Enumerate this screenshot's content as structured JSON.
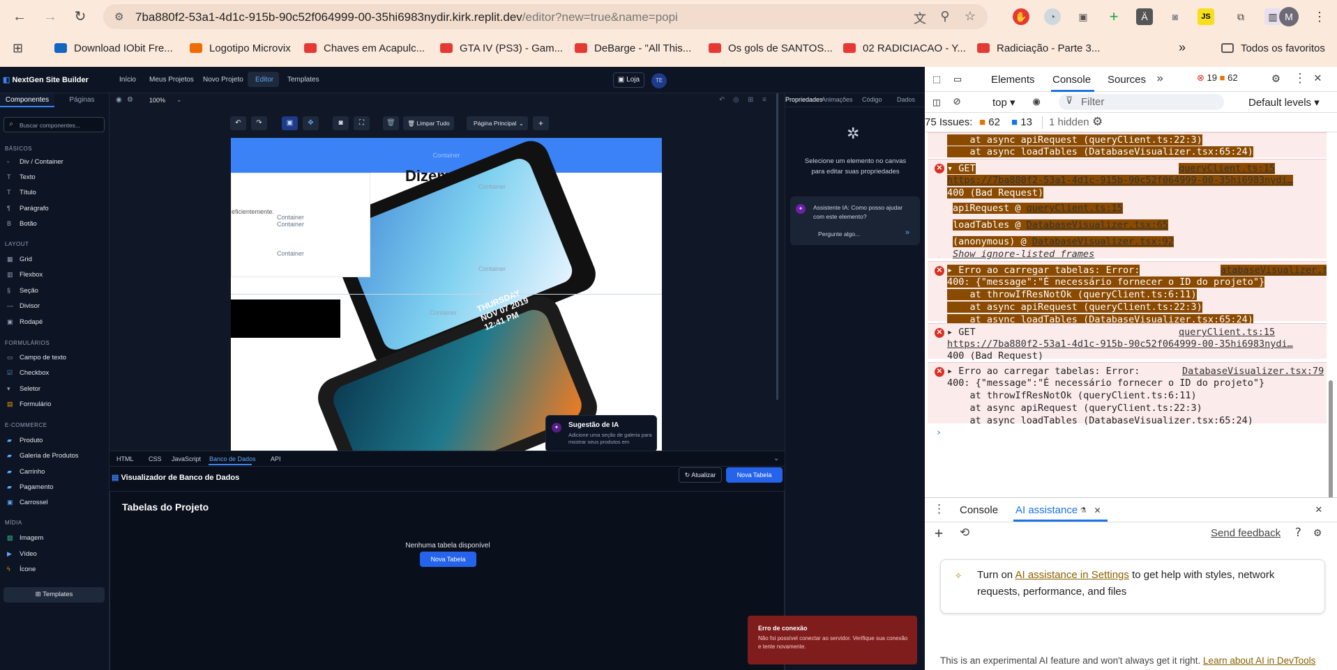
{
  "browser": {
    "url_host": "7ba880f2-53a1-4d1c-915b-90c52f064999-00-35hi6983nydir.kirk.replit.dev",
    "url_path": "/editor?new=true&name=popi",
    "bookmarks": [
      "Download IObit Fre...",
      "Logotipo Microvix",
      "Chaves em Acapulc...",
      "GTA IV (PS3) - Gam...",
      "DeBarge - \"All This...",
      "Os gols de SANTOS...",
      "02 RADICIACAO - Y...",
      "Radiciação - Parte 3..."
    ],
    "all_favorites": "Todos os favoritos",
    "profile_initial": "M"
  },
  "app": {
    "brand": "NextGen Site Builder",
    "nav": [
      "Início",
      "Meus Projetos",
      "Novo Projeto",
      "Editor",
      "Templates"
    ],
    "store": "Loja",
    "user_initials": "TE",
    "sidebar_tabs": [
      "Componentes",
      "Páginas"
    ],
    "search_placeholder": "Buscar componentes...",
    "sections": {
      "basic": "BÁSICOS",
      "layout": "LAYOUT",
      "forms": "FORMULÁRIOS",
      "ecommerce": "E-COMMERCE",
      "media": "MÍDIA"
    },
    "basic_items": [
      "Div / Container",
      "Texto",
      "Título",
      "Parágrafo",
      "Botão"
    ],
    "layout_items": [
      "Grid",
      "Flexbox",
      "Seção",
      "Divisor",
      "Rodapé"
    ],
    "form_items": [
      "Campo de texto",
      "Checkbox",
      "Seletor",
      "Formulário"
    ],
    "ecommerce_items": [
      "Produto",
      "Galeria de Produtos",
      "Carrinho",
      "Pagamento",
      "Carrossel"
    ],
    "media_items": [
      "Imagem",
      "Vídeo",
      "Ícone"
    ],
    "templates_button": "Templates",
    "zoom": "100%",
    "clear_all": "Limpar Tudo",
    "page_select": "Página Principal",
    "canvas": {
      "container_label": "Container",
      "heading": "Dizem",
      "text_fragment": "eficientemente.",
      "ai_suggestion_title": "Sugestão de IA",
      "ai_suggestion_text": "Adicione uma seção de galeria para mostrar seus produtos em",
      "phone_date": "THURSDAY\nNOV 07 2019\n12:41 PM"
    },
    "right_tabs": [
      "Propriedades",
      "Animações",
      "Código",
      "Dados"
    ],
    "right_empty": "Selecione um elemento no canvas para editar suas propriedades",
    "assistant_title": "Assistente IA: Como posso ajudar com este elemento?",
    "assistant_placeholder": "Pergunte algo...",
    "bottom_tabs": [
      "HTML",
      "CSS",
      "JavaScript",
      "Banco de Dados",
      "API"
    ],
    "db_title": "Visualizador de Banco de Dados",
    "refresh": "Atualizar",
    "new_table": "Nova Tabela",
    "tables_title": "Tabelas do Projeto",
    "no_tables": "Nenhuma tabela disponível",
    "toast_title": "Erro de conexão",
    "toast_text": "Não foi possível conectar ao servidor. Verifique sua conexão e tente novamente."
  },
  "devtools": {
    "tabs": [
      "Elements",
      "Console",
      "Sources"
    ],
    "errors": "19",
    "warnings": "62",
    "context": "top",
    "filter": "Filter",
    "levels": "Default levels",
    "issues_label": "75 Issues:",
    "issues_warn": "62",
    "issues_info": "13",
    "hidden": "1 hidden",
    "lines": {
      "l1": "    at async apiRequest (queryClient.ts:22:3)",
      "l2": "    at async loadTables (DatabaseVisualizer.tsx:65:24)",
      "get": "GET",
      "src15": "queryClient.ts:15",
      "url": "https://7ba880f2-53a1-4d1c-915b-90c52f064999-00-35hi6983nydi…",
      "bad": "400 (Bad Request)",
      "stack1": "apiRequest",
      "stack1src": "queryClient.ts:15",
      "stack2": "loadTables",
      "stack2src": "DatabaseVisualizer.tsx:65",
      "stack3": "(anonymous)",
      "stack3src": "DatabaseVisualizer.tsx:92",
      "ignore": "Show ignore-listed frames",
      "err_load": "Erro ao carregar tabelas: Error:",
      "err_src_hl": "atabaseVisualizer.tsx:79",
      "err_src": "DatabaseVisualizer.tsx:79",
      "err_msg": "400: {\"message\":\"É necessário fornecer o ID do projeto\"}",
      "throw": "    at throwIfResNotOk (queryClient.ts:6:11)"
    },
    "drawer_tabs": [
      "Console",
      "AI assistance"
    ],
    "send_feedback": "Send feedback",
    "ai_turn_on": "Turn on",
    "ai_link": "AI assistance in Settings",
    "ai_rest": "to get help with styles, network requests, performance, and files",
    "footer": "This is an experimental AI feature and won't always get it right.",
    "footer_link": "Learn about AI in DevTools"
  }
}
